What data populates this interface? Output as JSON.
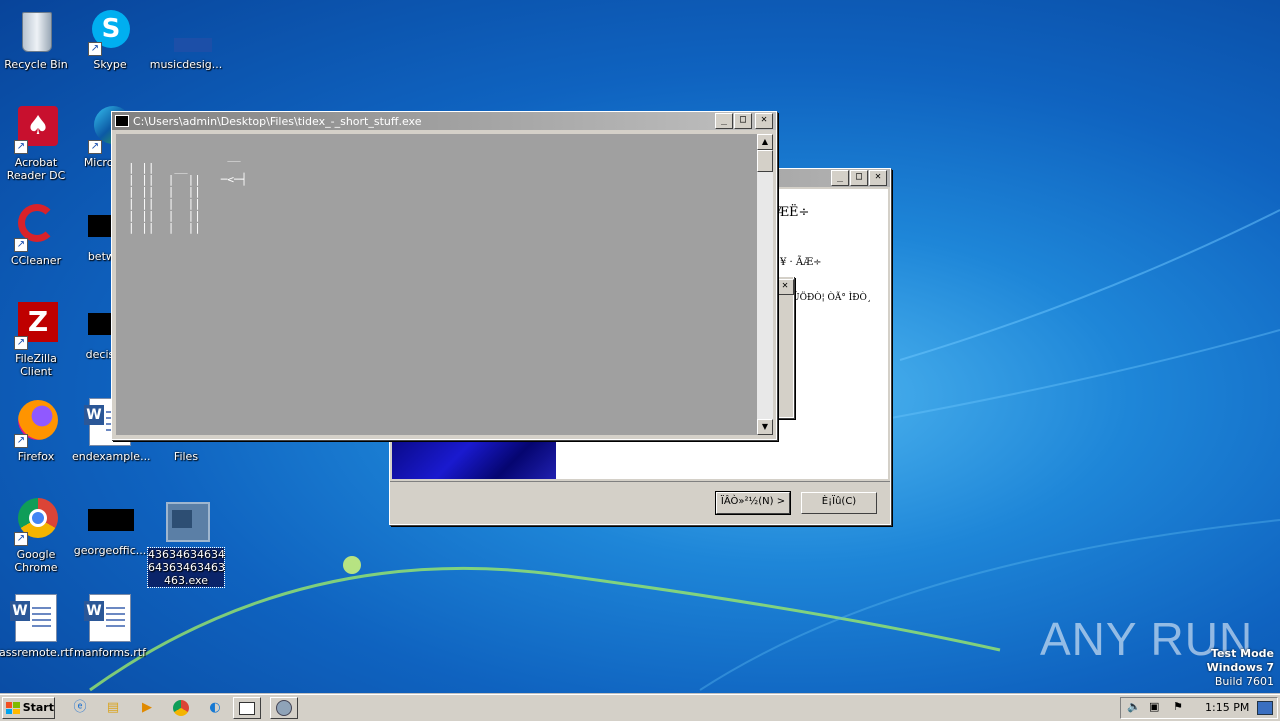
{
  "desktop": {
    "icons": [
      {
        "label": "Recycle Bin"
      },
      {
        "label": "Skype"
      },
      {
        "label": "musicdesig..."
      },
      {
        "label": "Acrobat Reader DC"
      },
      {
        "label": "Microso..."
      },
      {
        "label": "CCleaner"
      },
      {
        "label": "betwe..."
      },
      {
        "label": "FileZilla Client"
      },
      {
        "label": "decisio..."
      },
      {
        "label": "Firefox"
      },
      {
        "label": "endexample..."
      },
      {
        "label": "Files"
      },
      {
        "label": "Google Chrome"
      },
      {
        "label": "georgeoffic..."
      },
      {
        "label": "43634634634 64363463463 463.exe"
      },
      {
        "label": "assremote.rtf"
      },
      {
        "label": "manforms.rtf"
      }
    ]
  },
  "console_window": {
    "title": "C:\\Users\\admin\\Desktop\\Files\\tidex_-_short_stuff.exe",
    "ascii_art": "               __\n| ||   __\n| ||  |  ||   ─<─┤\n| ||  |  ||\n| ||  |  ||\n| ||  |  ||\n| ||  |  ||"
  },
  "installer_window": {
    "heading": "ÆË÷",
    "line1": "¥ · ÃÆ÷",
    "line2": "ÚÖÐÒ¦ ÒÃ° ÌÐÒ¸",
    "next_button": "ÏÂÒ»²½(N) >",
    "cancel_button": "È¡Ïû(C)"
  },
  "taskbar": {
    "start_label": "Start",
    "clock": "1:15 PM"
  },
  "watermark": "ANY RUN",
  "test_mode": {
    "line1": "Test Mode",
    "line2": "Windows 7",
    "line3": "Build 7601"
  },
  "colors": {
    "desktop_blue": "#1e86d8",
    "console_bg": "#a0a0a0",
    "classic_gray": "#d4d0c8"
  }
}
